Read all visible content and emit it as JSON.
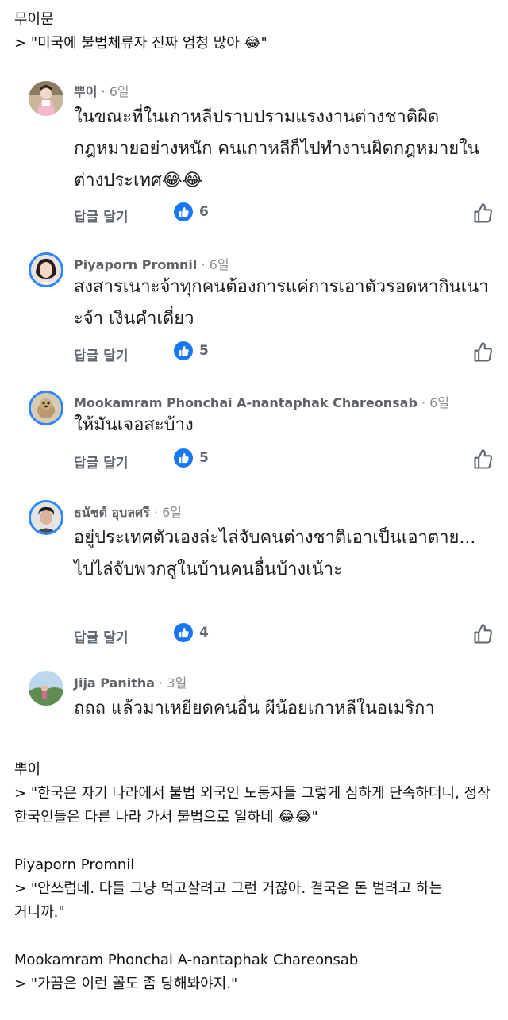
{
  "header": {
    "author": "무이문",
    "quote": "> \"미국에 불법체류자 진짜 엄청 많아 😂\""
  },
  "comments": [
    {
      "name": "뿌이",
      "time": " · 6일",
      "text": "ในขณะที่ในเกาหลีปราบปรามแรงงานต่างชาติผิดกฎหมายอย่างหนัก คนเกาหลีก็ไปทำงานผิดกฎหมายในต่างประเทศ😂😂",
      "reply_label": "답글 달기",
      "likes": "6",
      "avatar": "avatar-photo-woman-hanbok"
    },
    {
      "name": "Piyaporn Promnil",
      "time": " · 6일",
      "text": "สงสารเนาะจ้าทุกคนต้องการแค่การเอาตัวรอดหากินเนาะจ้า เงินคำเดี่ยว",
      "reply_label": "답글 달기",
      "likes": "5",
      "avatar": "avatar-photo-woman"
    },
    {
      "name": "Mookamram Phonchai A-nantaphak Chareonsab",
      "time": " · 6일",
      "text": "ให้มันเจอสะบ้าง",
      "reply_label": "답글 달기",
      "likes": "5",
      "avatar": "avatar-photo-dog"
    },
    {
      "name": "ธนัชต์ อุบลศรี",
      "time": " · 6일",
      "text": "อยู่ประเทศตัวเองล่ะไล่จับคนต่างชาติเอาเป็นเอาตาย... ไปไล่จับพวกสูในบ้านคนอื่นบ้างเน้าะ",
      "reply_label": "답글 달기",
      "likes": "4",
      "avatar": "avatar-photo-man"
    },
    {
      "name": "Jija Panitha",
      "time": " · 3일",
      "text": "ถถถ แล้วมาเหยียดคนอื่น ผีน้อยเกาหลีในอเมริกา",
      "avatar": "avatar-photo-landscape"
    }
  ],
  "translations": [
    {
      "author": "뿌이",
      "quote": "> \"한국은 자기 나라에서 불법 외국인 노동자들 그렇게 심하게 단속하더니, 정작 한국인들은 다른 나라 가서 불법으로 일하네 😂😂\""
    },
    {
      "author": "Piyaporn Promnil",
      "quote": "> \"안쓰럽네. 다들 그냥 먹고살려고 그런 거잖아. 결국은 돈 벌려고 하는 거니까.\""
    },
    {
      "author": "Mookamram Phonchai A-nantaphak Chareonsab",
      "quote": "> \"가끔은 이런 꼴도 좀 당해봐야지.\""
    }
  ],
  "colors": {
    "like_blue": "#1877f2",
    "ring_blue": "#2d88ff",
    "meta_gray": "#606770"
  }
}
